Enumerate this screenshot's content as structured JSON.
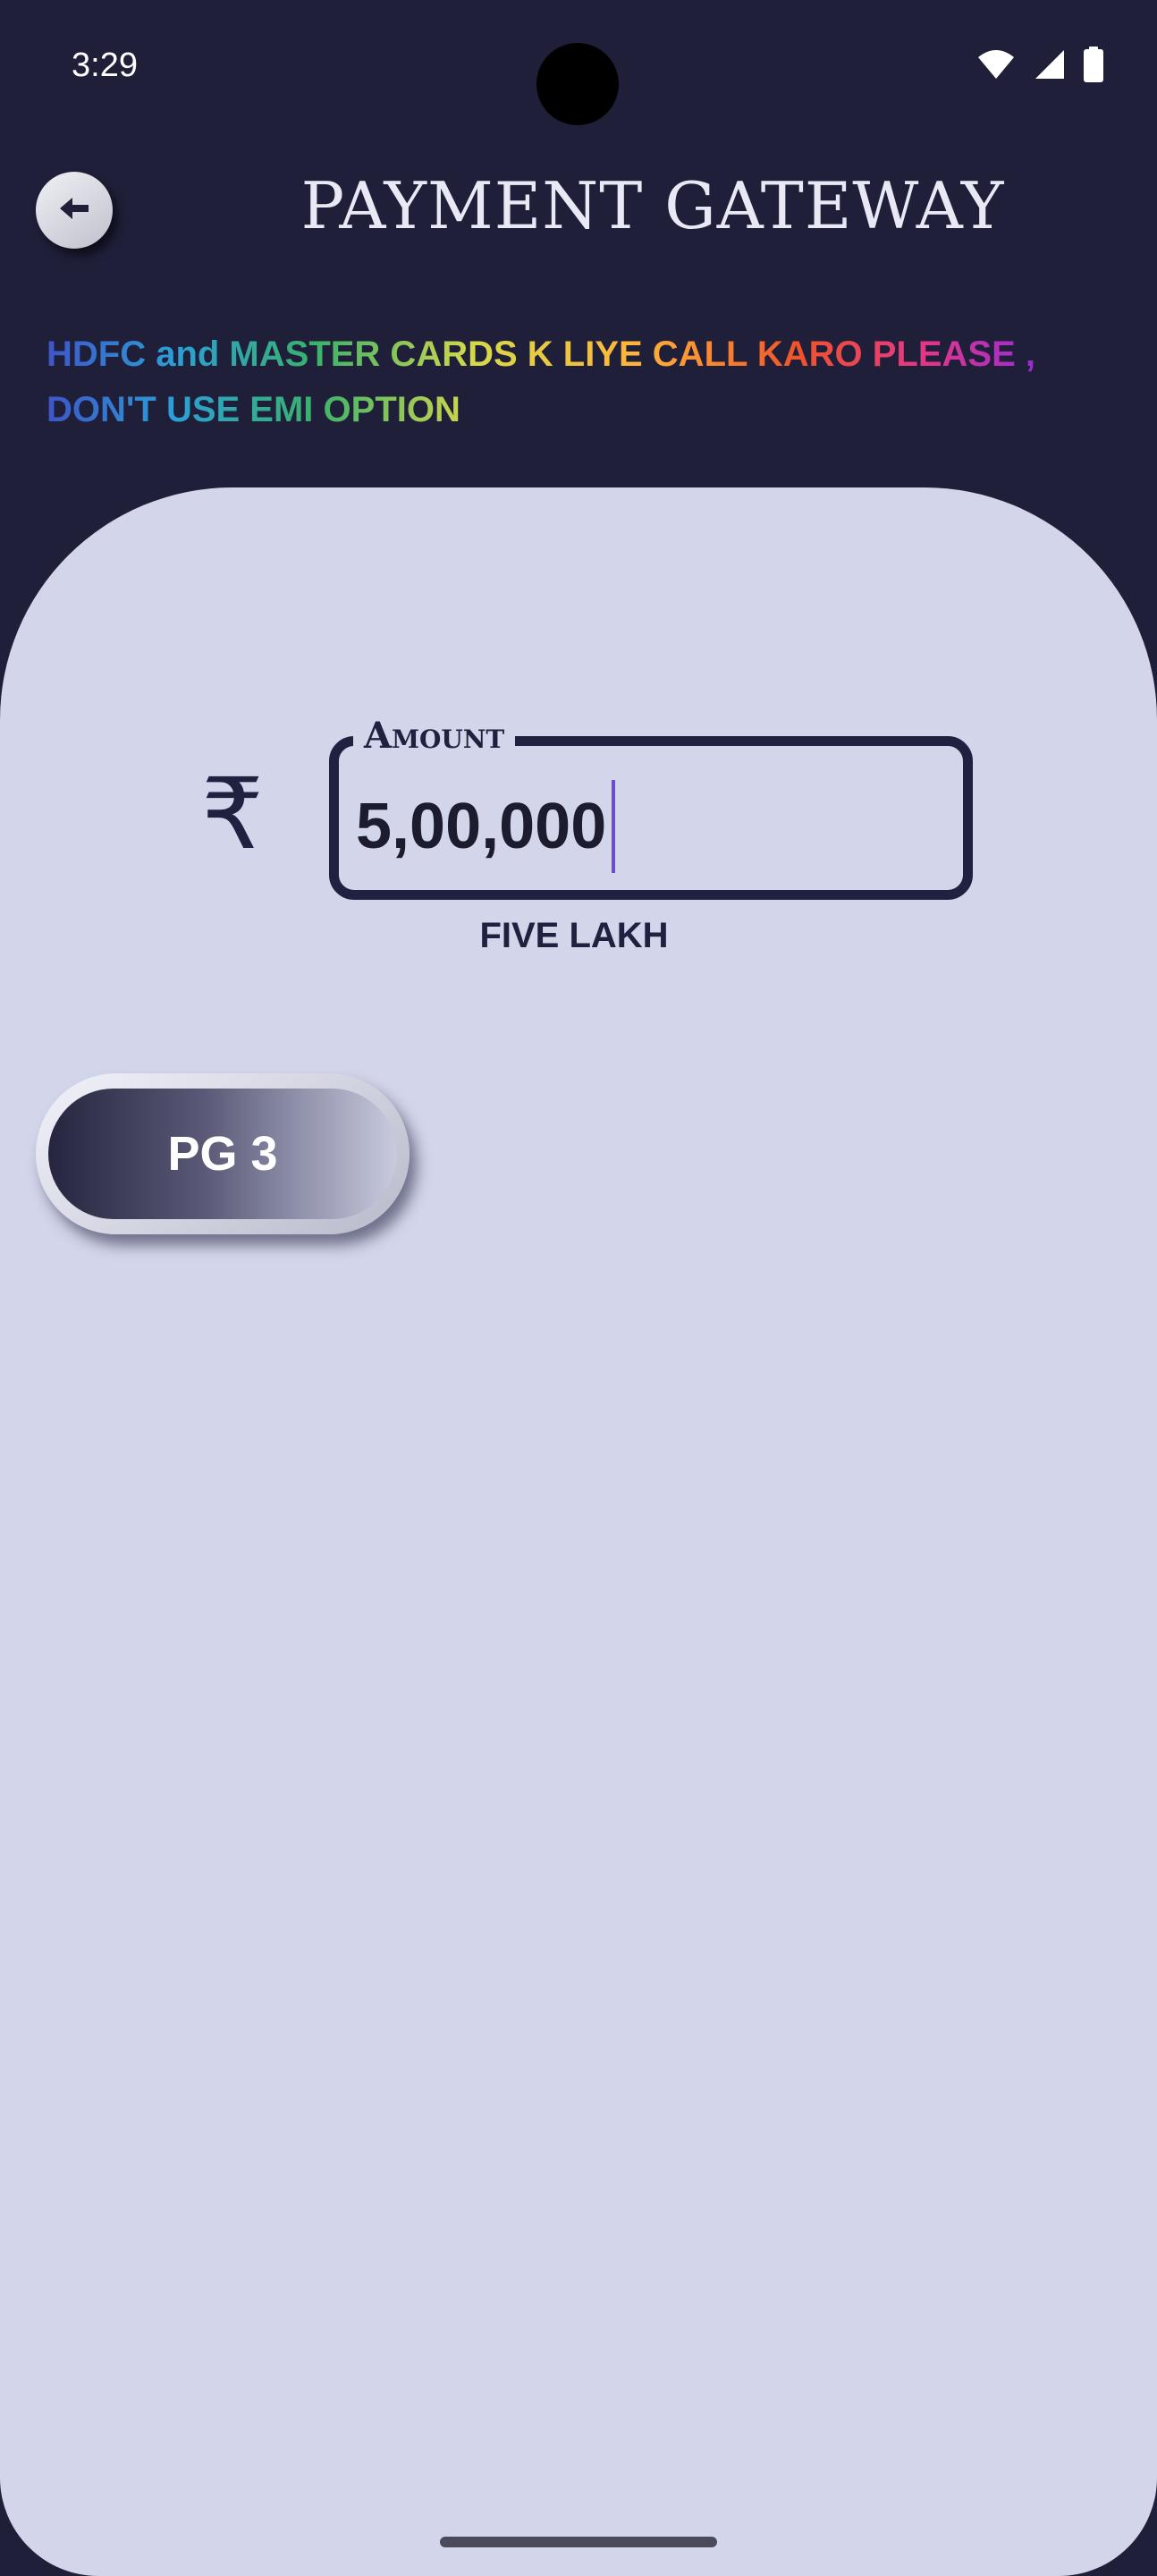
{
  "status_bar": {
    "time": "3:29",
    "icons": [
      "wifi-icon",
      "cellular-signal-icon",
      "battery-icon"
    ]
  },
  "header": {
    "back_icon": "arrow-left-icon",
    "title": "PAYMENT GATEWAY"
  },
  "notice": {
    "text": "HDFC and MASTER CARDS K LIYE CALL KARO PLEASE , DON'T USE EMI OPTION"
  },
  "amount": {
    "currency_icon": "rupee-icon",
    "currency_symbol": "₹",
    "label": "Amount",
    "value": "5,00,000",
    "in_words": "FIVE LAKH"
  },
  "actions": {
    "pg_button_label": "PG 3"
  },
  "colors": {
    "header_background": "#1f1f3a",
    "card_background": "#d3d6ea",
    "text_dark": "#202040",
    "caret": "#6a4fc8"
  }
}
